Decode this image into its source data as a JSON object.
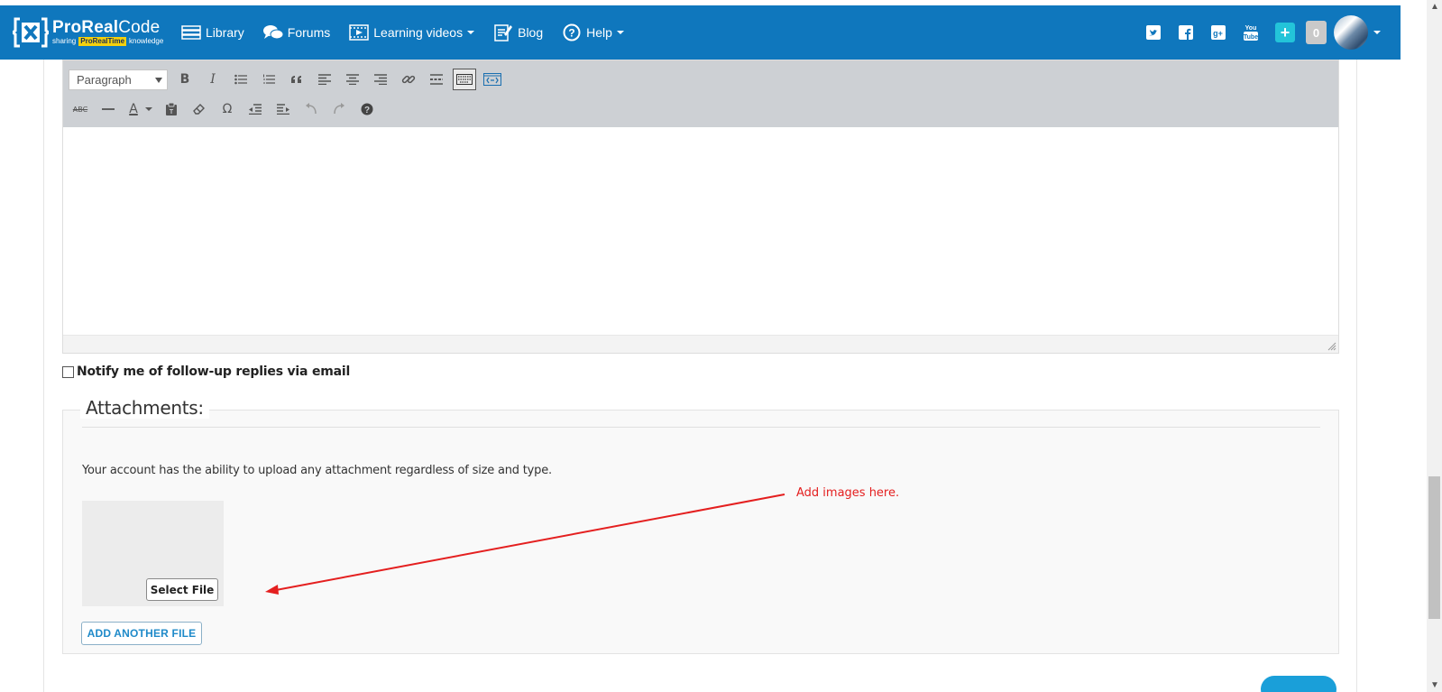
{
  "header": {
    "logo_title_bold": "ProReal",
    "logo_title_light": "Code",
    "logo_sub_left": "sharing",
    "logo_sub_highlight": "ProRealTime",
    "logo_sub_right": "knowledge",
    "nav": [
      {
        "label": "Library",
        "icon": "library-icon"
      },
      {
        "label": "Forums",
        "icon": "forums-icon"
      },
      {
        "label": "Learning videos",
        "icon": "video-icon",
        "dropdown": true
      },
      {
        "label": "Blog",
        "icon": "blog-icon"
      },
      {
        "label": "Help",
        "icon": "help-icon",
        "dropdown": true
      }
    ],
    "social": [
      "twitter-icon",
      "facebook-icon",
      "google-plus-icon",
      "youtube-icon"
    ],
    "plus_label": "+",
    "notification_count": "0",
    "brand_color": "#0f77bd"
  },
  "editor": {
    "format_select_value": "Paragraph",
    "row1_tools": [
      "bold",
      "italic",
      "bullet-list",
      "numbered-list",
      "blockquote",
      "align-left",
      "align-center",
      "align-right",
      "link",
      "read-more",
      "toolbar-toggle",
      "distraction-free"
    ],
    "row2_tools": [
      "strikethrough",
      "horizontal-line",
      "text-color",
      "paste-text",
      "clear-formatting",
      "special-character",
      "outdent",
      "indent",
      "undo",
      "redo",
      "keyboard-shortcuts"
    ],
    "bold_glyph": "B",
    "italic_glyph": "I",
    "strike_glyph": "ABC",
    "omega_glyph": "Ω",
    "textcolor_glyph": "A",
    "content": ""
  },
  "notify": {
    "label": "Notify me of follow-up replies via email",
    "checked": false
  },
  "attachments": {
    "legend": "Attachments:",
    "info": "Your account has the ability to upload any attachment regardless of size and type.",
    "select_file_label": "Select File",
    "add_another_label": "ADD ANOTHER FILE"
  },
  "annotation": {
    "text": "Add images here.",
    "color": "#e41f1f"
  }
}
